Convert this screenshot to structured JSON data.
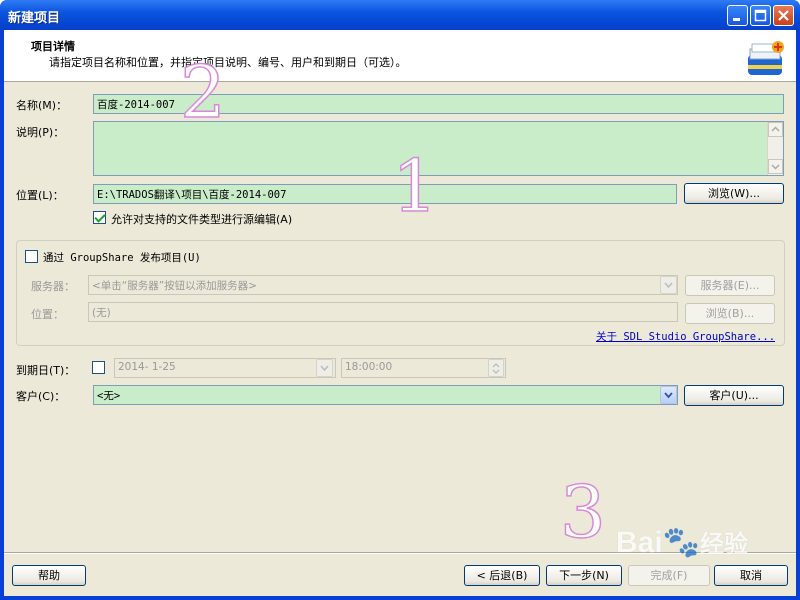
{
  "window": {
    "title": "新建项目"
  },
  "header": {
    "title": "项目详情",
    "description": "请指定项目名称和位置，并指定项目说明、编号、用户和到期日（可选）。"
  },
  "form": {
    "name_label": "名称(M)：",
    "name_value": "百度-2014-007",
    "description_label": "说明(P)：",
    "description_value": "",
    "location_label": "位置(L)：",
    "location_value": "E:\\TRADOS翻译\\项目\\百度-2014-007",
    "browse_button": "浏览(W)...",
    "allow_edit_label": "允许对支持的文件类型进行源编辑(A)",
    "allow_edit_checked": true
  },
  "groupshare": {
    "publish_label": "通过 GroupShare 发布项目(U)",
    "publish_checked": false,
    "server_label": "服务器：",
    "server_value": "<单击“服务器”按钮以添加服务器>",
    "server_button": "服务器(E)...",
    "location_label": "位置：",
    "location_value": "(无)",
    "browse_button": "浏览(B)...",
    "about_link": "关于 SDL Studio GroupShare..."
  },
  "due": {
    "label": "到期日(T)：",
    "checked": false,
    "date_value": "2014- 1-25",
    "time_value": "18:00:00"
  },
  "customer": {
    "label": "客户(C)：",
    "value": "<无>",
    "button": "客户(U)..."
  },
  "footer": {
    "help_button": "帮助",
    "back_button": "< 后退(B)",
    "next_button": "下一步(N)",
    "finish_button": "完成(F)",
    "cancel_button": "取消"
  },
  "annotations": [
    "2",
    "1",
    "3"
  ],
  "watermark": {
    "brand": "Bai",
    "brand_suffix": "经验"
  },
  "colors": {
    "title_bar": "#0b55e0",
    "field_bg": "#c9ecc9",
    "dialog_bg": "#ece9d8",
    "annotation_stroke": "#d88ad8",
    "link": "#0000cc"
  }
}
